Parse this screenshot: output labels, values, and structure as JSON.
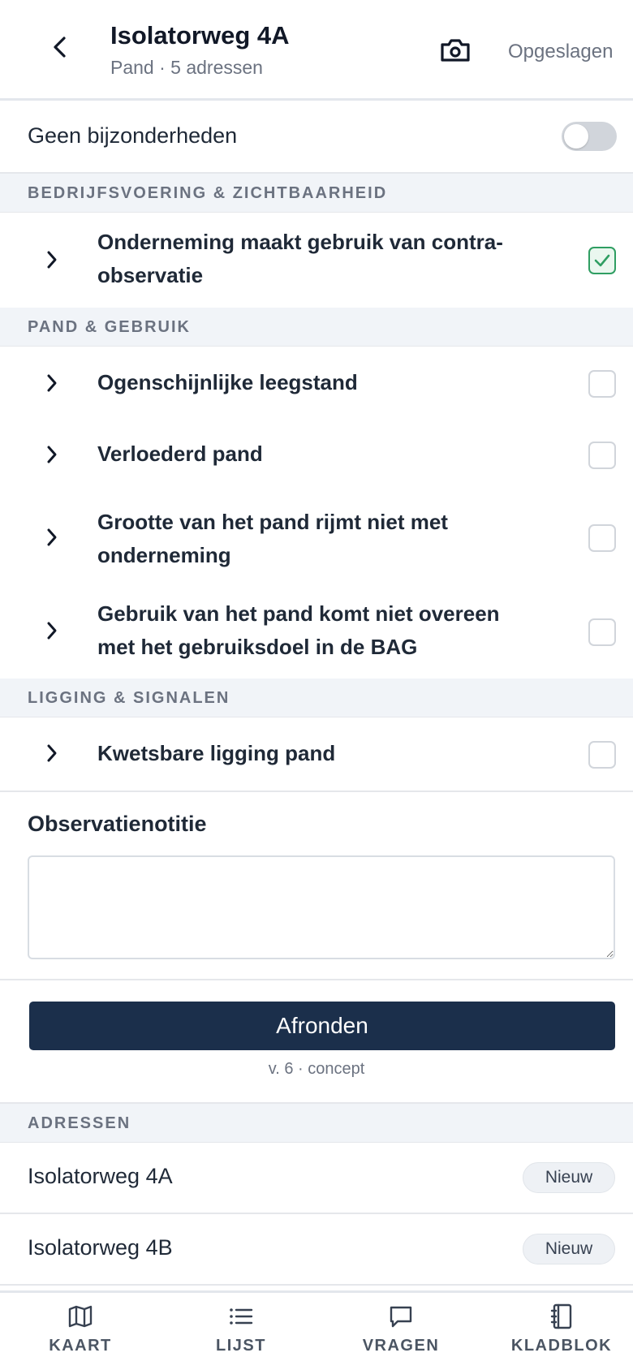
{
  "header": {
    "title": "Isolatorweg 4A",
    "subtitle": "Pand · 5 adressen",
    "status": "Opgeslagen",
    "back_icon": "chevron-left-icon",
    "camera_icon": "camera-icon"
  },
  "no_details": {
    "label": "Geen bijzonderheden",
    "enabled": false
  },
  "sections": [
    {
      "title": "BEDRIJFSVOERING & ZICHTBAARHEID",
      "items": [
        {
          "label": "Onderneming maakt gebruik van contra-observatie",
          "line1": "Onderneming maakt gebruik van contra-",
          "line2": "observatie",
          "checked": true
        }
      ]
    },
    {
      "title": "PAND & GEBRUIK",
      "items": [
        {
          "label": "Ogenschijnlijke leegstand",
          "checked": false
        },
        {
          "label": "Verloederd pand",
          "checked": false
        },
        {
          "label": "Grootte van het pand rijmt niet met onderneming",
          "line1": "Grootte van het pand rijmt niet met",
          "line2": "onderneming",
          "checked": false
        },
        {
          "label": "Gebruik van het pand komt niet overeen met het gebruiksdoel in de BAG",
          "line1": "Gebruik van het pand komt niet overeen",
          "line2": "met het gebruiksdoel in de BAG",
          "checked": false
        }
      ]
    },
    {
      "title": "LIGGING & SIGNALEN",
      "items": [
        {
          "label": "Kwetsbare ligging pand",
          "checked": false
        }
      ]
    }
  ],
  "note": {
    "label": "Observatienotitie",
    "value": "",
    "placeholder": ""
  },
  "finish": {
    "label": "Afronden",
    "version": "v. 6 · concept"
  },
  "addresses": {
    "title": "ADRESSEN",
    "items": [
      {
        "address": "Isolatorweg 4A",
        "badge": "Nieuw"
      },
      {
        "address": "Isolatorweg 4B",
        "badge": "Nieuw"
      }
    ]
  },
  "nav": [
    {
      "label": "KAART",
      "icon": "map-icon"
    },
    {
      "label": "LIJST",
      "icon": "list-icon"
    },
    {
      "label": "VRAGEN",
      "icon": "chat-bubble-icon"
    },
    {
      "label": "KLADBLOK",
      "icon": "notebook-icon"
    }
  ],
  "colors": {
    "primary_button": "#1b2f4b",
    "checked_green": "#2f9e62",
    "section_bg": "#f1f4f8"
  }
}
